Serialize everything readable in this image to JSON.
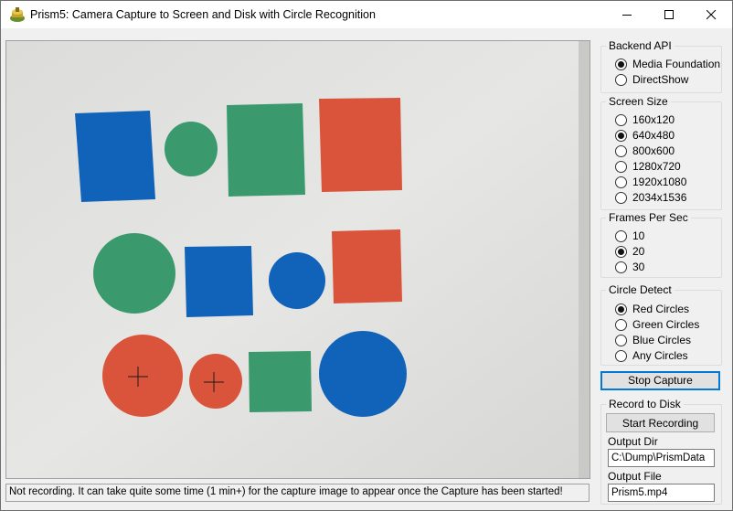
{
  "window": {
    "title": "Prism5: Camera Capture to Screen and Disk with Circle Recognition"
  },
  "camera": {
    "detected_circle_count": 2
  },
  "status": {
    "text": "Not recording. It can take quite some time (1 min+) for the capture image to appear once the Capture has been started!"
  },
  "backend_api": {
    "title": "Backend API",
    "options": [
      {
        "label": "Media Foundation",
        "checked": true
      },
      {
        "label": "DirectShow",
        "checked": false
      }
    ]
  },
  "screen_size": {
    "title": "Screen Size",
    "options": [
      {
        "label": "160x120",
        "checked": false
      },
      {
        "label": "640x480",
        "checked": true
      },
      {
        "label": "800x600",
        "checked": false
      },
      {
        "label": "1280x720",
        "checked": false
      },
      {
        "label": "1920x1080",
        "checked": false
      },
      {
        "label": "2034x1536",
        "checked": false
      }
    ]
  },
  "fps": {
    "title": "Frames Per Sec",
    "options": [
      {
        "label": "10",
        "checked": false
      },
      {
        "label": "20",
        "checked": true
      },
      {
        "label": "30",
        "checked": false
      }
    ]
  },
  "circle_detect": {
    "title": "Circle Detect",
    "options": [
      {
        "label": "Red Circles",
        "checked": true
      },
      {
        "label": "Green Circles",
        "checked": false
      },
      {
        "label": "Blue Circles",
        "checked": false
      },
      {
        "label": "Any Circles",
        "checked": false
      }
    ]
  },
  "capture": {
    "button_label": "Stop Capture"
  },
  "record": {
    "title": "Record to Disk",
    "button_label": "Start Recording",
    "output_dir_label": "Output Dir",
    "output_dir_value": "C:\\Dump\\PrismData",
    "output_file_label": "Output File",
    "output_file_value": "Prism5.mp4"
  },
  "colors": {
    "red": "#d9543a",
    "green": "#3a9a6e",
    "blue": "#1063b8",
    "focus": "#0078d7"
  },
  "icons": [
    "app-icon",
    "minimize-icon",
    "maximize-icon",
    "close-icon"
  ]
}
